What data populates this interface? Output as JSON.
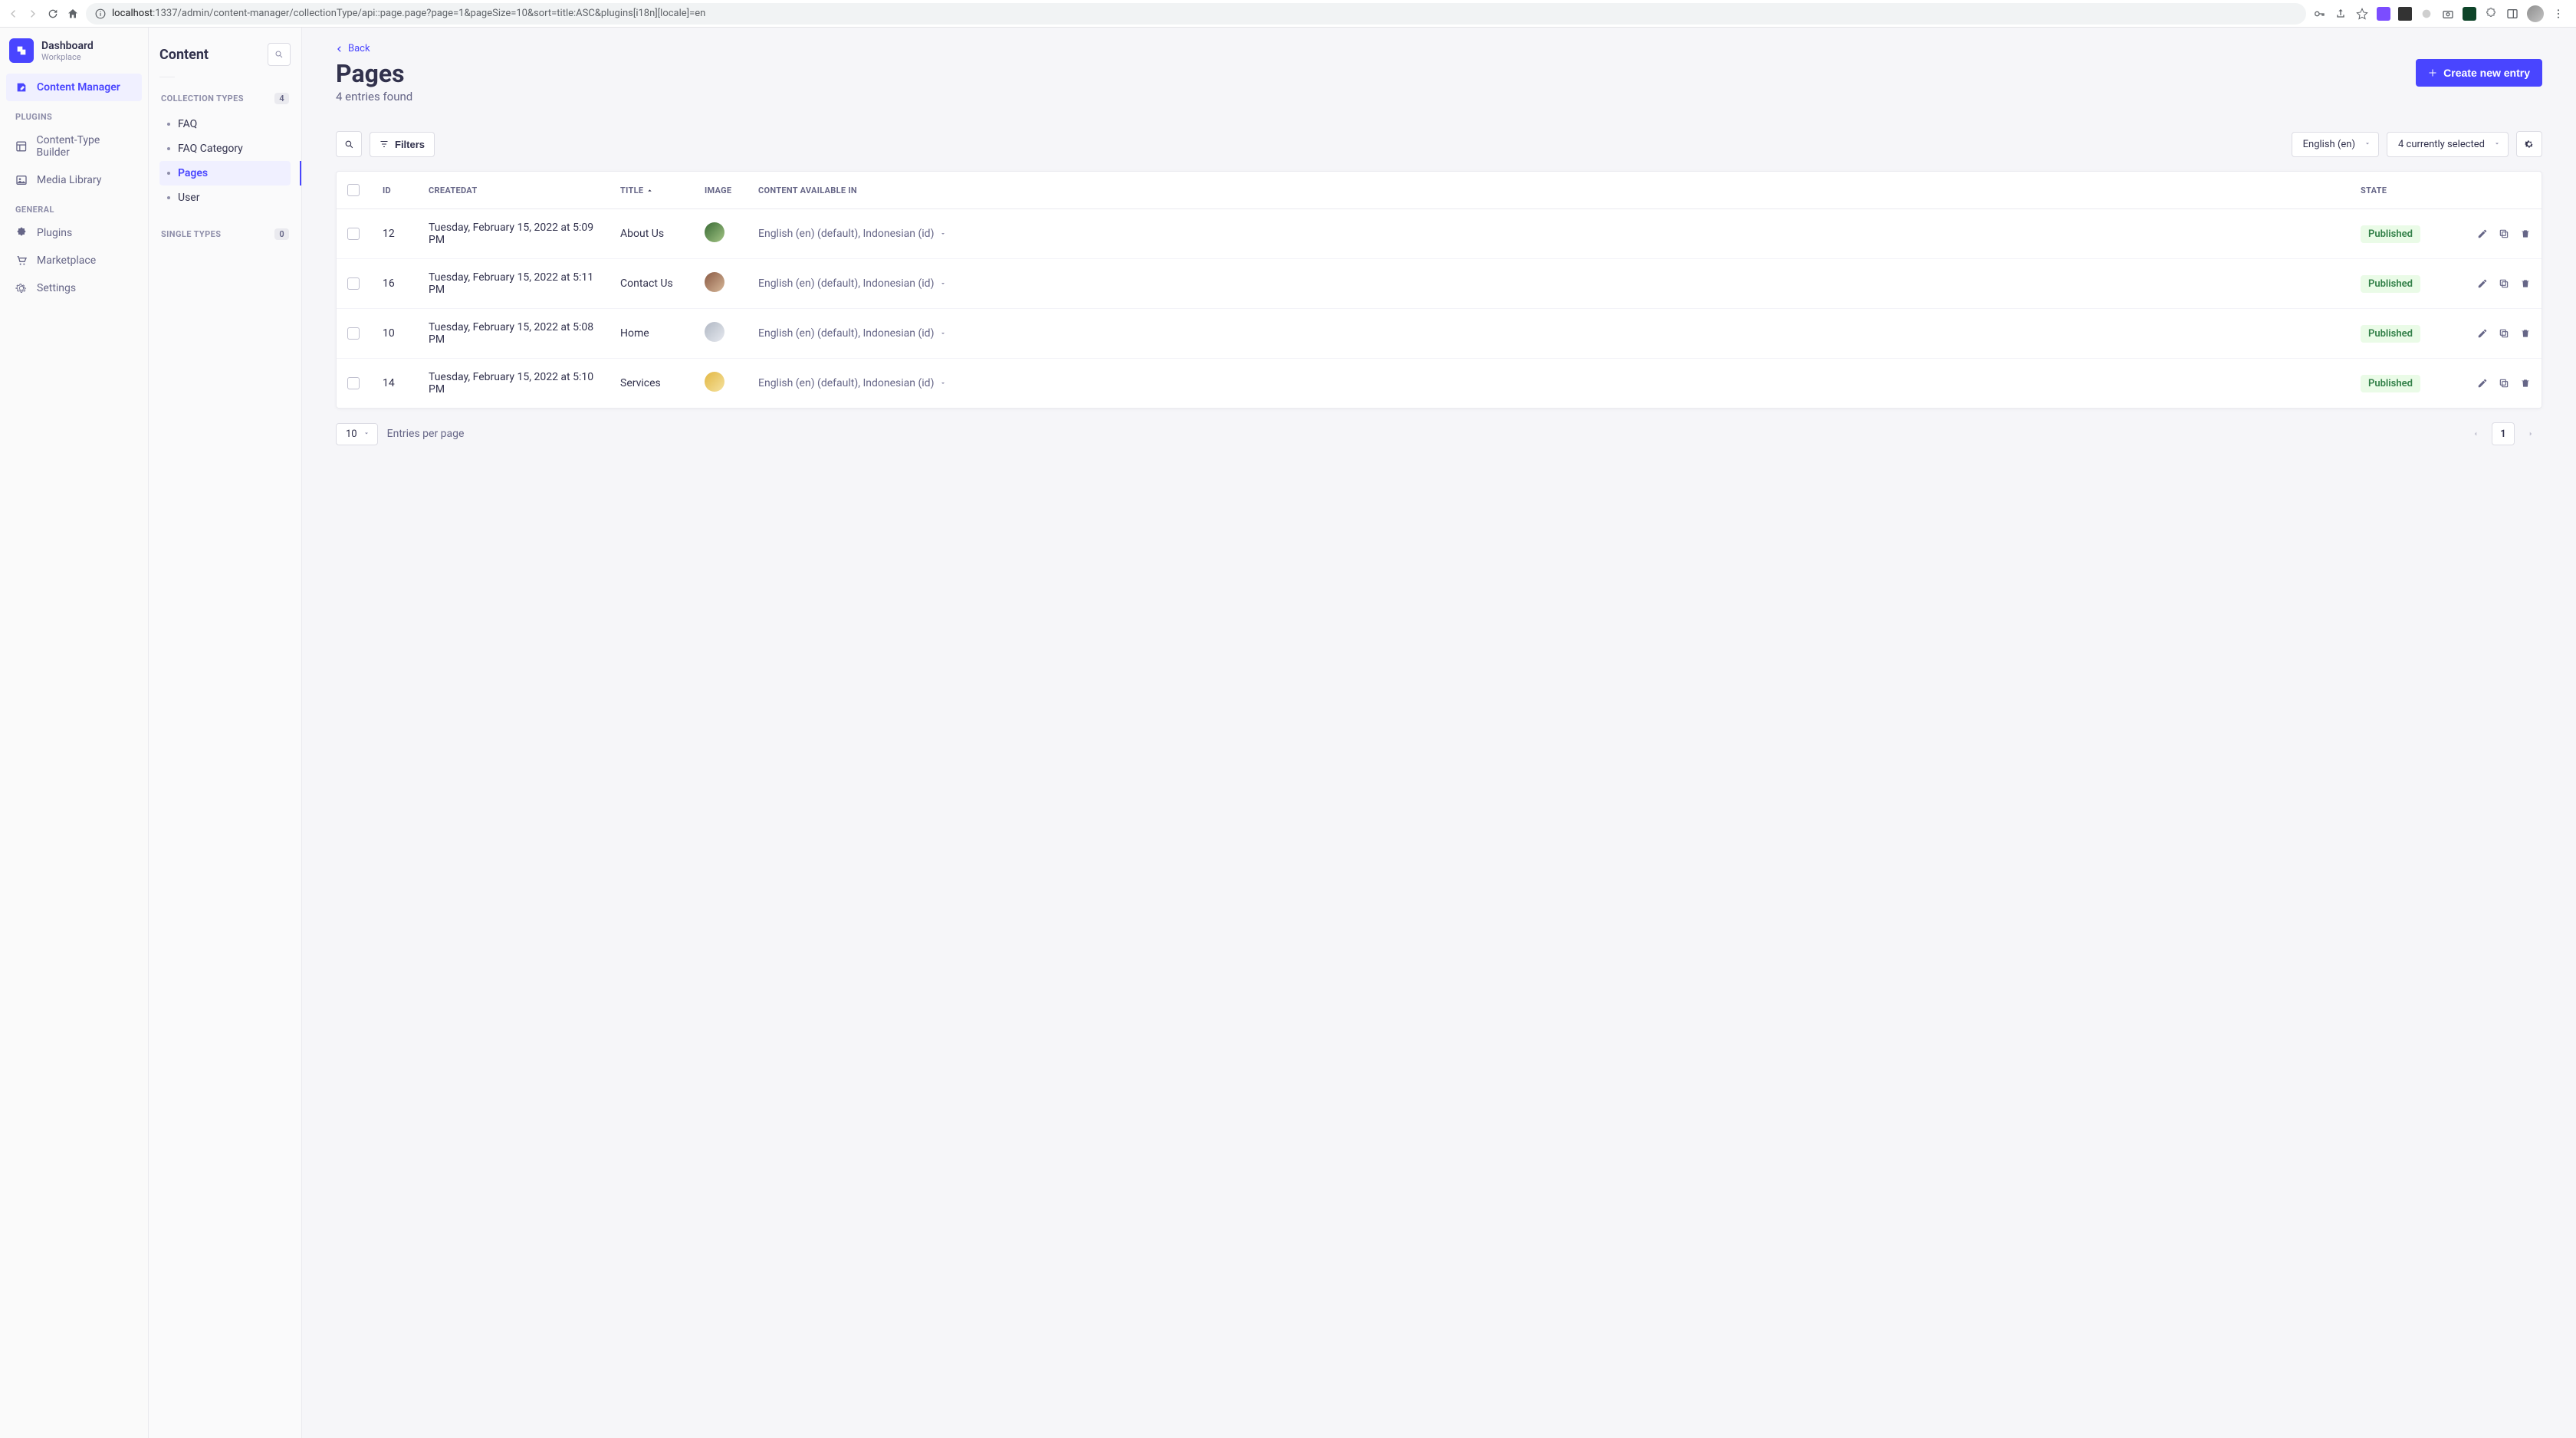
{
  "browser": {
    "url_prefix": "localhost",
    "url_rest": ":1337/admin/content-manager/collectionType/api::page.page?page=1&pageSize=10&sort=title:ASC&plugins[i18n][locale]=en"
  },
  "sidebar": {
    "brand_title": "Dashboard",
    "brand_sub": "Workplace",
    "items": [
      {
        "label": "Content Manager",
        "icon": "pencil-square"
      }
    ],
    "sections": [
      {
        "label": "Plugins",
        "items": [
          {
            "label": "Content-Type Builder",
            "icon": "layout"
          },
          {
            "label": "Media Library",
            "icon": "image"
          }
        ]
      },
      {
        "label": "General",
        "items": [
          {
            "label": "Plugins",
            "icon": "puzzle"
          },
          {
            "label": "Marketplace",
            "icon": "cart"
          },
          {
            "label": "Settings",
            "icon": "gear"
          }
        ]
      }
    ]
  },
  "content_panel": {
    "title": "Content",
    "collection_label": "Collection Types",
    "collection_count": "4",
    "collection_items": [
      {
        "label": "FAQ"
      },
      {
        "label": "FAQ Category"
      },
      {
        "label": "Pages",
        "active": true
      },
      {
        "label": "User"
      }
    ],
    "single_label": "Single Types",
    "single_count": "0"
  },
  "header": {
    "back": "Back",
    "title": "Pages",
    "subtitle": "4 entries found",
    "create_label": "Create new entry"
  },
  "toolbar": {
    "filters_label": "Filters",
    "locale_label": "English (en)",
    "columns_label": "4 currently selected"
  },
  "table": {
    "cols": {
      "id": "ID",
      "createdat": "CreatedAt",
      "title": "Title",
      "image": "Image",
      "content": "Content available in",
      "state": "State"
    },
    "rows": [
      {
        "id": "12",
        "createdat": "Tuesday, February 15, 2022 at 5:09 PM",
        "title": "About Us",
        "thumb_bg": "linear-gradient(135deg,#3a6b35,#a3c585)",
        "locales": "English (en) (default), Indonesian (id)",
        "state": "Published"
      },
      {
        "id": "16",
        "createdat": "Tuesday, February 15, 2022 at 5:11 PM",
        "title": "Contact Us",
        "thumb_bg": "linear-gradient(135deg,#8a5a44,#d7b899)",
        "locales": "English (en) (default), Indonesian (id)",
        "state": "Published"
      },
      {
        "id": "10",
        "createdat": "Tuesday, February 15, 2022 at 5:08 PM",
        "title": "Home",
        "thumb_bg": "linear-gradient(135deg,#b0b7c3,#e7eaf0)",
        "locales": "English (en) (default), Indonesian (id)",
        "state": "Published"
      },
      {
        "id": "14",
        "createdat": "Tuesday, February 15, 2022 at 5:10 PM",
        "title": "Services",
        "thumb_bg": "linear-gradient(135deg,#e2b743,#f5e2a0)",
        "locales": "English (en) (default), Indonesian (id)",
        "state": "Published"
      }
    ]
  },
  "footer": {
    "per_page_value": "10",
    "per_page_label": "Entries per page",
    "current_page": "1"
  }
}
